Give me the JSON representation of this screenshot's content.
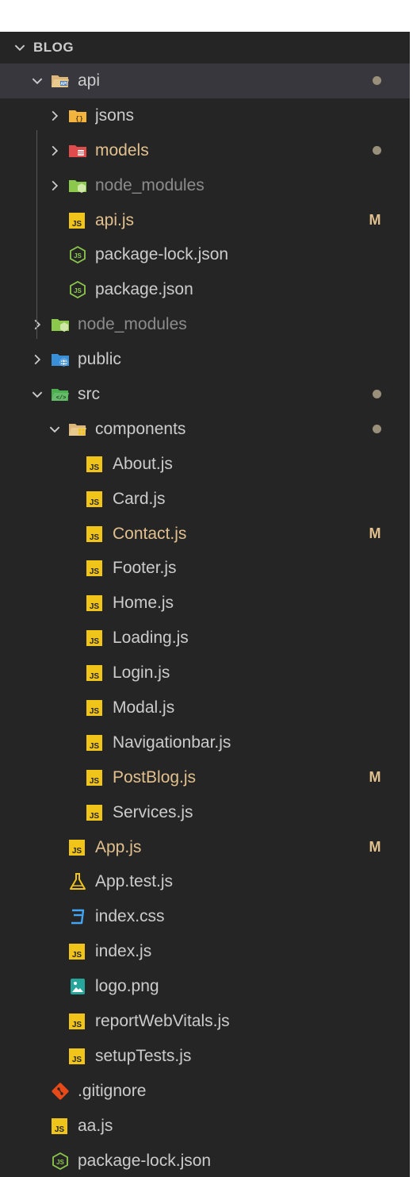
{
  "explorer": {
    "root": {
      "label": "BLOG"
    },
    "items": [
      {
        "label": "api",
        "type": "folder",
        "expanded": true,
        "depth": 1,
        "icon": "folder-api-open-icon",
        "status": "dot",
        "selected": true
      },
      {
        "label": "jsons",
        "type": "folder",
        "expanded": false,
        "depth": 2,
        "icon": "folder-json-icon"
      },
      {
        "label": "models",
        "type": "folder",
        "expanded": false,
        "depth": 2,
        "icon": "folder-database-icon",
        "status": "dot",
        "modified": true
      },
      {
        "label": "node_modules",
        "type": "folder",
        "expanded": false,
        "depth": 2,
        "icon": "folder-node-icon",
        "ignored": true
      },
      {
        "label": "api.js",
        "type": "file",
        "depth": 2,
        "icon": "javascript-file-icon",
        "status": "M",
        "modified": true
      },
      {
        "label": "package-lock.json",
        "type": "file",
        "depth": 2,
        "icon": "nodejs-file-icon"
      },
      {
        "label": "package.json",
        "type": "file",
        "depth": 2,
        "icon": "nodejs-file-icon"
      },
      {
        "label": "node_modules",
        "type": "folder",
        "expanded": false,
        "depth": 1,
        "icon": "folder-node-icon",
        "ignored": true
      },
      {
        "label": "public",
        "type": "folder",
        "expanded": false,
        "depth": 1,
        "icon": "folder-public-icon"
      },
      {
        "label": "src",
        "type": "folder",
        "expanded": true,
        "depth": 1,
        "icon": "folder-src-open-icon",
        "status": "dot"
      },
      {
        "label": "components",
        "type": "folder",
        "expanded": true,
        "depth": 2,
        "icon": "folder-components-open-icon",
        "status": "dot"
      },
      {
        "label": "About.js",
        "type": "file",
        "depth": 3,
        "icon": "javascript-file-icon"
      },
      {
        "label": "Card.js",
        "type": "file",
        "depth": 3,
        "icon": "javascript-file-icon"
      },
      {
        "label": "Contact.js",
        "type": "file",
        "depth": 3,
        "icon": "javascript-file-icon",
        "status": "M",
        "modified": true
      },
      {
        "label": "Footer.js",
        "type": "file",
        "depth": 3,
        "icon": "javascript-file-icon"
      },
      {
        "label": "Home.js",
        "type": "file",
        "depth": 3,
        "icon": "javascript-file-icon"
      },
      {
        "label": "Loading.js",
        "type": "file",
        "depth": 3,
        "icon": "javascript-file-icon"
      },
      {
        "label": "Login.js",
        "type": "file",
        "depth": 3,
        "icon": "javascript-file-icon"
      },
      {
        "label": "Modal.js",
        "type": "file",
        "depth": 3,
        "icon": "javascript-file-icon"
      },
      {
        "label": "Navigationbar.js",
        "type": "file",
        "depth": 3,
        "icon": "javascript-file-icon"
      },
      {
        "label": "PostBlog.js",
        "type": "file",
        "depth": 3,
        "icon": "javascript-file-icon",
        "status": "M",
        "modified": true
      },
      {
        "label": "Services.js",
        "type": "file",
        "depth": 3,
        "icon": "javascript-file-icon"
      },
      {
        "label": "App.js",
        "type": "file",
        "depth": 2,
        "icon": "javascript-file-icon",
        "status": "M",
        "modified": true
      },
      {
        "label": "App.test.js",
        "type": "file",
        "depth": 2,
        "icon": "flask-test-icon"
      },
      {
        "label": "index.css",
        "type": "file",
        "depth": 2,
        "icon": "css-file-icon"
      },
      {
        "label": "index.js",
        "type": "file",
        "depth": 2,
        "icon": "javascript-file-icon"
      },
      {
        "label": "logo.png",
        "type": "file",
        "depth": 2,
        "icon": "image-file-icon"
      },
      {
        "label": "reportWebVitals.js",
        "type": "file",
        "depth": 2,
        "icon": "javascript-file-icon"
      },
      {
        "label": "setupTests.js",
        "type": "file",
        "depth": 2,
        "icon": "javascript-file-icon"
      },
      {
        "label": ".gitignore",
        "type": "file",
        "depth": 1,
        "icon": "git-file-icon"
      },
      {
        "label": "aa.js",
        "type": "file",
        "depth": 1,
        "icon": "javascript-file-icon"
      },
      {
        "label": "package-lock.json",
        "type": "file",
        "depth": 1,
        "icon": "nodejs-file-icon"
      }
    ]
  },
  "colors": {
    "background": "#252526",
    "selected_row": "#37373d",
    "text": "#cccccc",
    "modified_text": "#e2c08d",
    "ignored_text": "#8c8c8c",
    "js_icon": "#f0c419",
    "folder": "#dcb67a"
  }
}
